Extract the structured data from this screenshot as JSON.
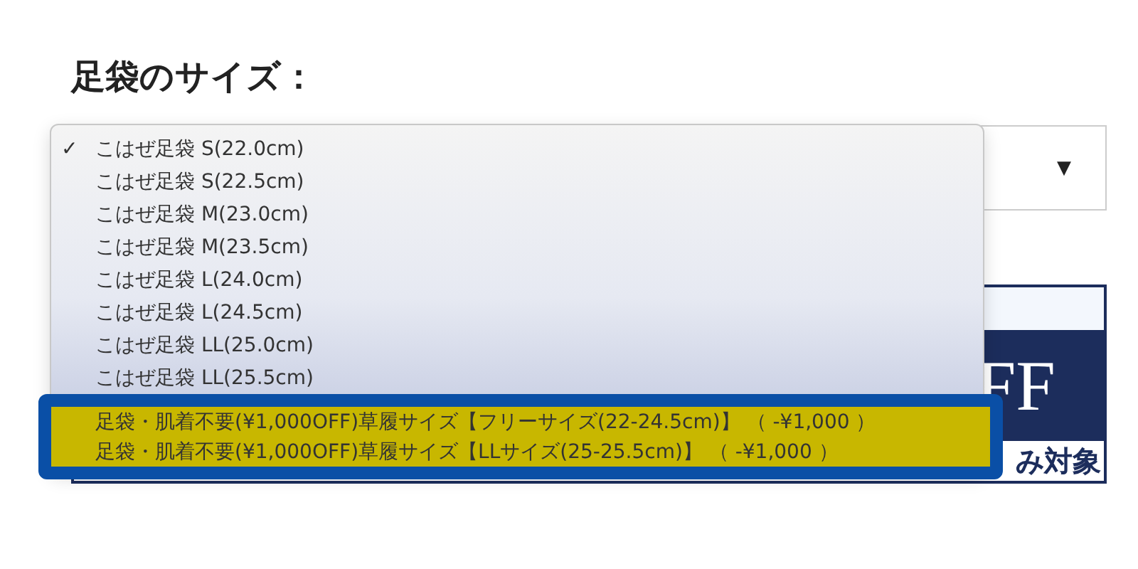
{
  "heading": "足袋のサイズ：",
  "select": {
    "arrow": "▼"
  },
  "banner": {
    "texts": [
      "FF",
      "み対象"
    ]
  },
  "dropdown": {
    "check_mark": "✓",
    "options": [
      {
        "label": "こはぜ足袋 S(22.0cm)",
        "selected": true,
        "highlighted": false
      },
      {
        "label": "こはぜ足袋 S(22.5cm)",
        "selected": false,
        "highlighted": false
      },
      {
        "label": "こはぜ足袋 M(23.0cm)",
        "selected": false,
        "highlighted": false
      },
      {
        "label": "こはぜ足袋 M(23.5cm)",
        "selected": false,
        "highlighted": false
      },
      {
        "label": "こはぜ足袋 L(24.0cm)",
        "selected": false,
        "highlighted": false
      },
      {
        "label": "こはぜ足袋 L(24.5cm)",
        "selected": false,
        "highlighted": false
      },
      {
        "label": "こはぜ足袋 LL(25.0cm)",
        "selected": false,
        "highlighted": false
      },
      {
        "label": "こはぜ足袋 LL(25.5cm)",
        "selected": false,
        "highlighted": false
      },
      {
        "label": "足袋・肌着不要(¥1,000OFF)草履サイズ【フリーサイズ(22-24.5cm)】 （ -¥1,000 ）",
        "selected": false,
        "highlighted": true
      },
      {
        "label": "足袋・肌着不要(¥1,000OFF)草履サイズ【LLサイズ(25-25.5cm)】 （ -¥1,000 ）",
        "selected": false,
        "highlighted": true
      }
    ]
  }
}
